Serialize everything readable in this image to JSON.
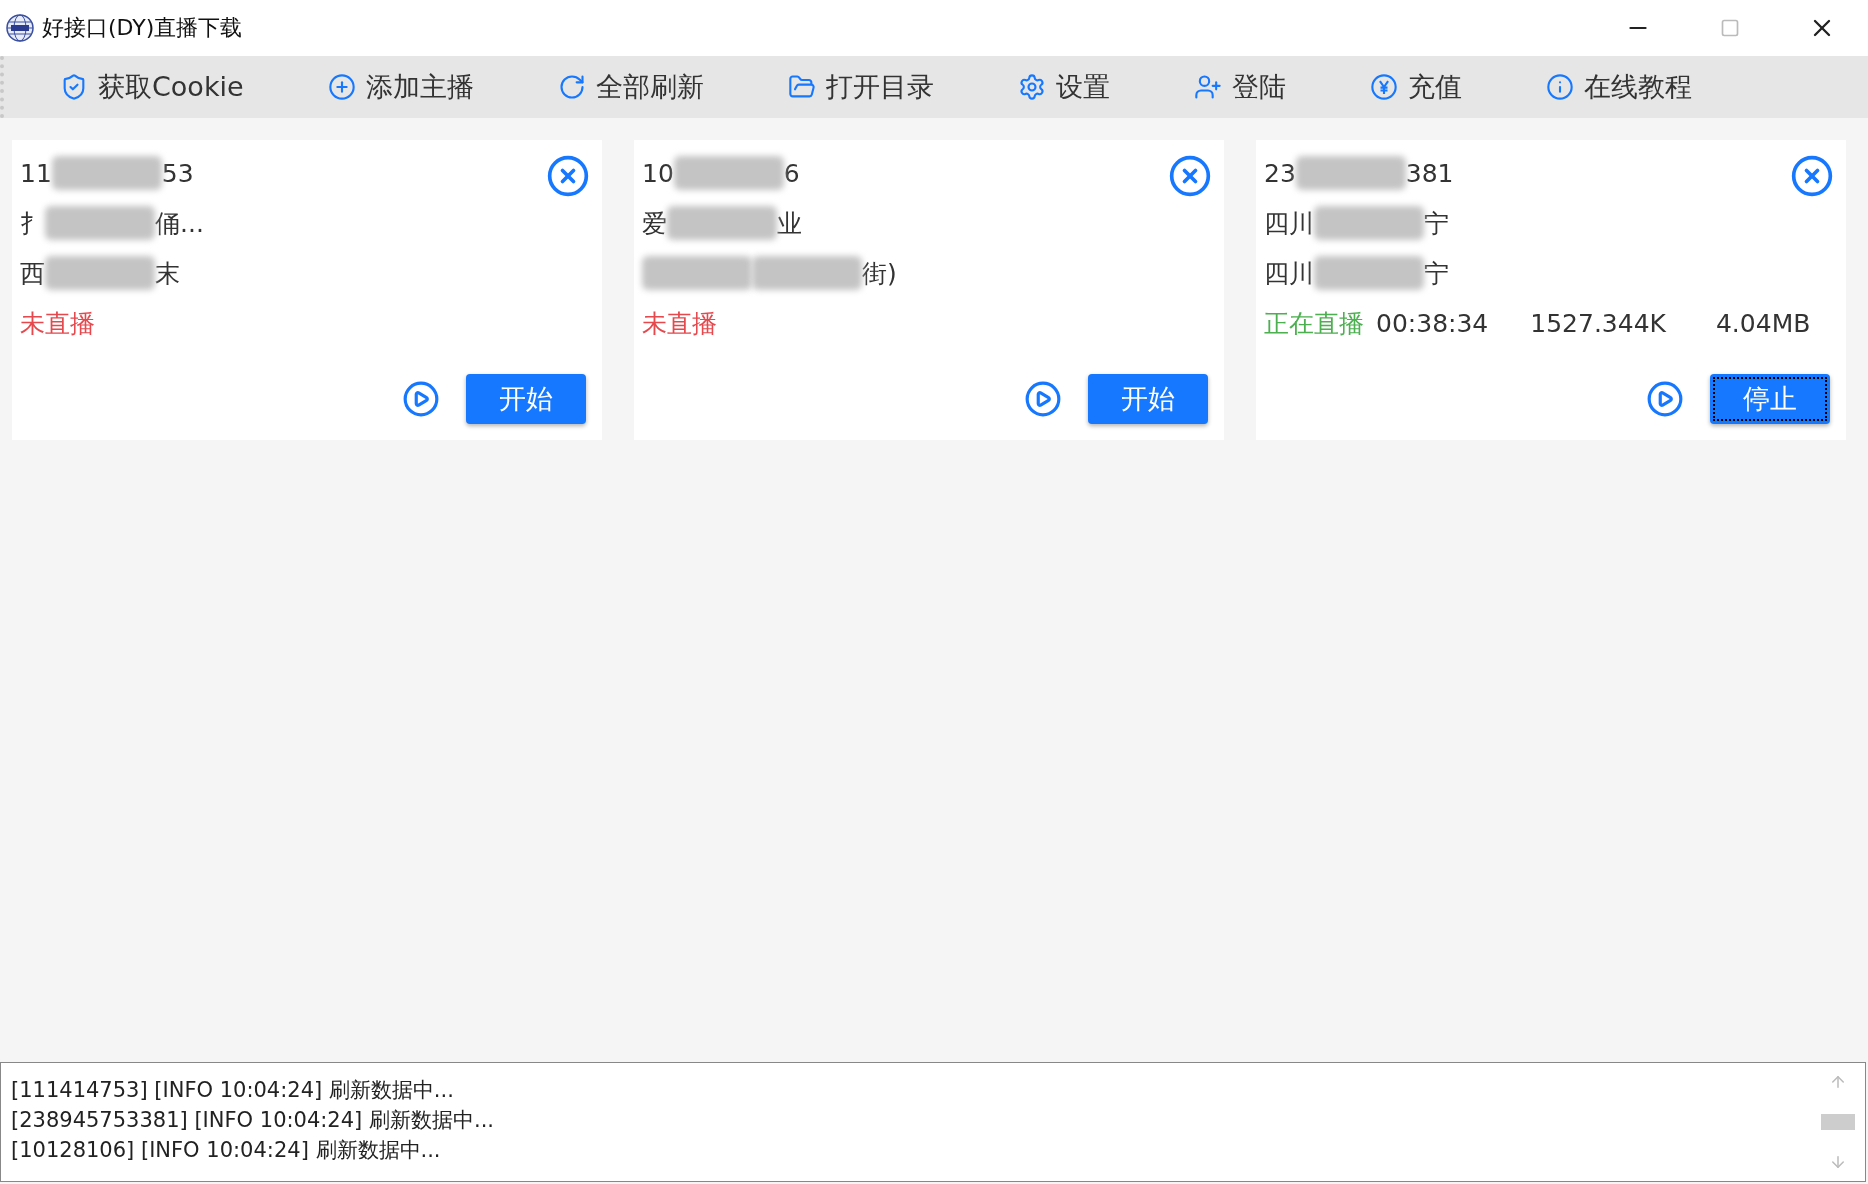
{
  "window": {
    "title": "好接口(DY)直播下载"
  },
  "toolbar": [
    {
      "label": "获取Cookie"
    },
    {
      "label": "添加主播"
    },
    {
      "label": "全部刷新"
    },
    {
      "label": "打开目录"
    },
    {
      "label": "设置"
    },
    {
      "label": "登陆"
    },
    {
      "label": "充值"
    },
    {
      "label": "在线教程"
    }
  ],
  "cards": [
    {
      "lines": [
        [
          {
            "kind": "text",
            "text": "11"
          },
          {
            "kind": "blur"
          },
          {
            "kind": "text",
            "text": "53"
          }
        ],
        [
          {
            "kind": "text",
            "text": "扌"
          },
          {
            "kind": "blur"
          },
          {
            "kind": "text",
            "text": "俑..."
          }
        ],
        [
          {
            "kind": "text",
            "text": "西"
          },
          {
            "kind": "blur"
          },
          {
            "kind": "text",
            "text": "末"
          }
        ]
      ],
      "status": {
        "kind": "offline",
        "text": "未直播"
      },
      "action": {
        "label": "开始",
        "focused": false
      }
    },
    {
      "lines": [
        [
          {
            "kind": "text",
            "text": "10"
          },
          {
            "kind": "blur"
          },
          {
            "kind": "text",
            "text": "6"
          }
        ],
        [
          {
            "kind": "text",
            "text": "爱"
          },
          {
            "kind": "blur"
          },
          {
            "kind": "text",
            "text": "业"
          }
        ],
        [
          {
            "kind": "blur"
          },
          {
            "kind": "blur"
          },
          {
            "kind": "text",
            "text": "街)"
          }
        ]
      ],
      "status": {
        "kind": "offline",
        "text": "未直播"
      },
      "action": {
        "label": "开始",
        "focused": false
      }
    },
    {
      "lines": [
        [
          {
            "kind": "text",
            "text": "23"
          },
          {
            "kind": "blur"
          },
          {
            "kind": "text",
            "text": "381"
          }
        ],
        [
          {
            "kind": "text",
            "text": "四川"
          },
          {
            "kind": "blur"
          },
          {
            "kind": "text",
            "text": "宁"
          }
        ],
        [
          {
            "kind": "text",
            "text": "四川"
          },
          {
            "kind": "blur"
          },
          {
            "kind": "text",
            "text": "宁"
          }
        ]
      ],
      "status": {
        "kind": "live",
        "text": "正在直播",
        "duration": "00:38:34",
        "speed": "1527.344K",
        "size": "4.04MB"
      },
      "action": {
        "label": "停止",
        "focused": true
      }
    }
  ],
  "log": [
    "[111414753] [INFO 10:04:24] 刷新数据中...",
    "[238945753381] [INFO 10:04:24] 刷新数据中...",
    "[10128106] [INFO 10:04:24] 刷新数据中..."
  ]
}
